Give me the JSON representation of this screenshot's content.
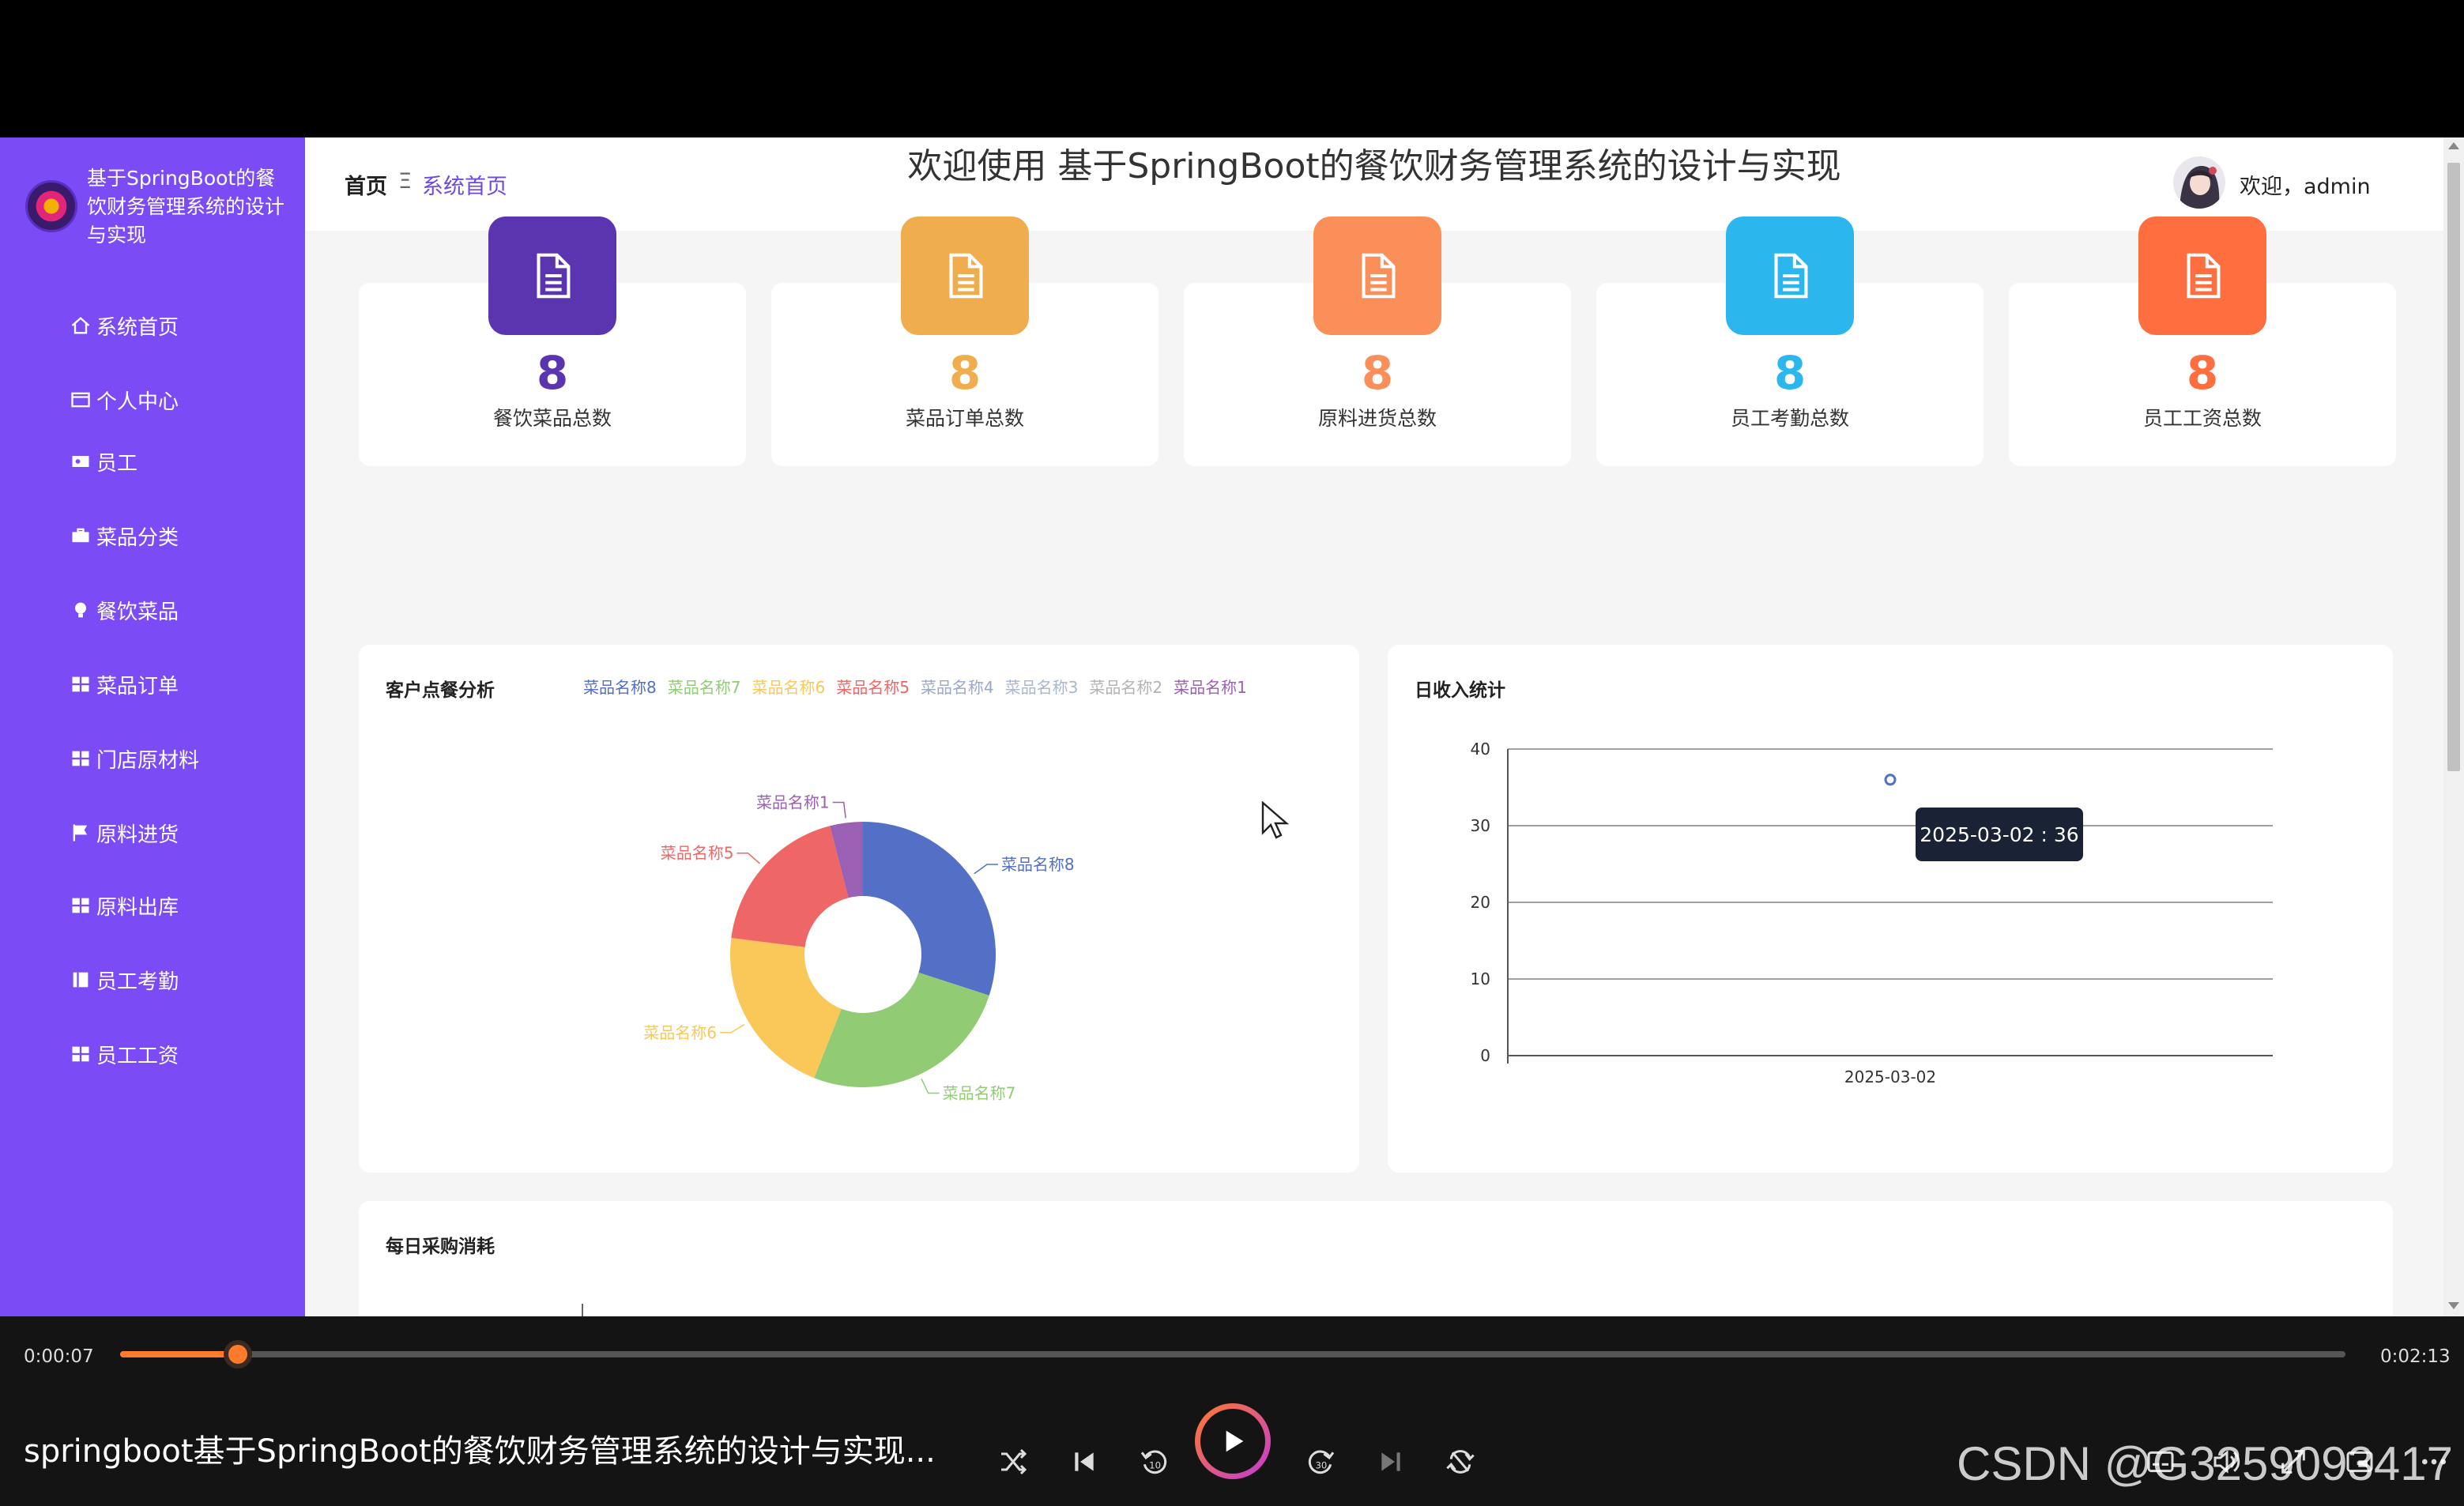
{
  "sidebar": {
    "brand_title": "基于SpringBoot的餐饮财务管理系统的设计与实现",
    "items": [
      {
        "label": "系统首页",
        "icon": "home-icon"
      },
      {
        "label": "个人中心",
        "icon": "window-icon"
      },
      {
        "label": "员工",
        "icon": "user-card-icon"
      },
      {
        "label": "菜品分类",
        "icon": "briefcase-icon"
      },
      {
        "label": "餐饮菜品",
        "icon": "bulb-icon"
      },
      {
        "label": "菜品订单",
        "icon": "grid-icon"
      },
      {
        "label": "门店原材料",
        "icon": "grid-icon"
      },
      {
        "label": "原料进货",
        "icon": "flag-icon"
      },
      {
        "label": "原料出库",
        "icon": "grid-icon"
      },
      {
        "label": "员工考勤",
        "icon": "book-icon"
      },
      {
        "label": "员工工资",
        "icon": "grid-icon"
      }
    ]
  },
  "header": {
    "breadcrumb_home": "首页",
    "breadcrumb_sep": "Ξ",
    "breadcrumb_current": "系统首页",
    "welcome": "欢迎，admin"
  },
  "main": {
    "title": "欢迎使用 基于SpringBoot的餐饮财务管理系统的设计与实现",
    "stats": [
      {
        "value": "8",
        "label": "餐饮菜品总数",
        "color": "#5b35b0"
      },
      {
        "value": "8",
        "label": "菜品订单总数",
        "color": "#f0ad4e"
      },
      {
        "value": "8",
        "label": "原料进货总数",
        "color": "#fa8f5a"
      },
      {
        "value": "8",
        "label": "员工考勤总数",
        "color": "#2bb7ee"
      },
      {
        "value": "8",
        "label": "员工工资总数",
        "color": "#ff6e3f"
      }
    ],
    "pie_panel_title": "客户点餐分析",
    "line_panel_title": "日收入统计",
    "bottom_panel_title": "每日采购消耗",
    "tooltip": "2025-03-02 : 36"
  },
  "chart_data": [
    {
      "type": "pie",
      "title": "客户点餐分析",
      "donut": true,
      "legend_position": "top",
      "legend": [
        "菜品名称8",
        "菜品名称7",
        "菜品名称6",
        "菜品名称5",
        "菜品名称4",
        "菜品名称3",
        "菜品名称2",
        "菜品名称1"
      ],
      "legend_colors": [
        "#5470c6",
        "#91cc75",
        "#fac858",
        "#ee6666",
        "#9aa9c8",
        "#a8b7cc",
        "#b3b3b3",
        "#9a60b4"
      ],
      "slices": [
        {
          "name": "菜品名称8",
          "value": 30,
          "color": "#5470c6"
        },
        {
          "name": "菜品名称7",
          "value": 26,
          "color": "#91cc75"
        },
        {
          "name": "菜品名称6",
          "value": 21,
          "color": "#fac858"
        },
        {
          "name": "菜品名称5",
          "value": 19,
          "color": "#ee6666"
        },
        {
          "name": "菜品名称1",
          "value": 4,
          "color": "#9a60b4"
        }
      ]
    },
    {
      "type": "line",
      "title": "日收入统计",
      "x": [
        "2025-03-02"
      ],
      "series": [
        {
          "values": [
            36
          ],
          "color": "#5470c6"
        }
      ],
      "ylim": [
        0,
        40
      ],
      "yticks": [
        0,
        10,
        20,
        30,
        40
      ],
      "grid": true
    }
  ],
  "player": {
    "time_current": "0:00:07",
    "time_total": "0:02:13",
    "progress": 0.053,
    "video_title": "springboot基于SpringBoot的餐饮财务管理系统的设计与实现...",
    "watermark": "CSDN @G3259093417"
  }
}
